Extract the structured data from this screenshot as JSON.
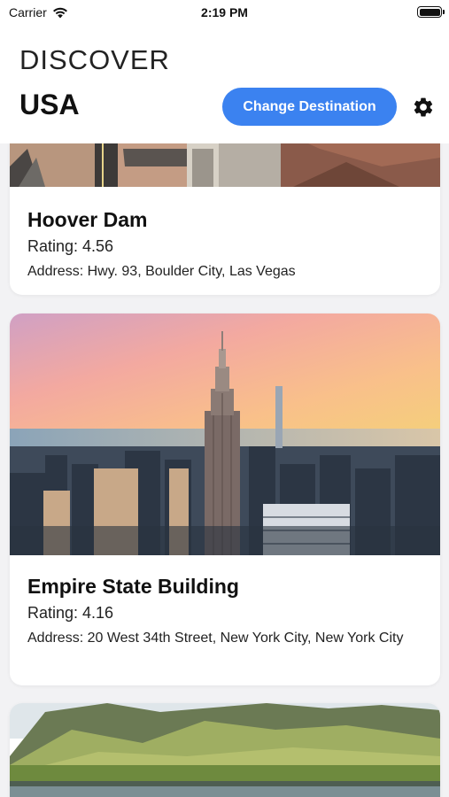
{
  "status_bar": {
    "carrier": "Carrier",
    "time": "2:19 PM"
  },
  "header": {
    "title": "DISCOVER",
    "country": "USA",
    "change_destination_label": "Change Destination",
    "accent_color": "#3b82f0"
  },
  "places": [
    {
      "name": "Hoover Dam",
      "rating": "Rating: 4.56",
      "address": "Address: Hwy. 93, Boulder City, Las Vegas",
      "image_icon": "canyon-road-photo"
    },
    {
      "name": "Empire State Building",
      "rating": "Rating: 4.16",
      "address": "Address: 20 West 34th Street, New York City, New York City",
      "image_icon": "city-skyline-photo"
    },
    {
      "name": "",
      "rating": "",
      "address": "",
      "image_icon": "mountain-lake-photo"
    }
  ]
}
